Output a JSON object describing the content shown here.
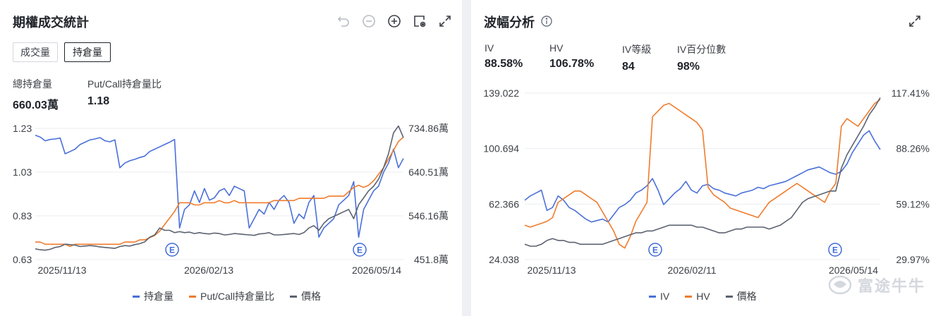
{
  "left": {
    "title": "期權成交統計",
    "tabs": [
      "成交量",
      "持倉量"
    ],
    "active_tab": 1,
    "stats": [
      {
        "label": "總持倉量",
        "value": "660.03萬"
      },
      {
        "label": "Put/Call持倉量比",
        "value": "1.18"
      }
    ],
    "legend": [
      "持倉量",
      "Put/Call持倉量比",
      "價格"
    ],
    "event_marker": "E"
  },
  "right": {
    "title": "波幅分析",
    "stats": [
      {
        "label": "IV",
        "value": "88.58%"
      },
      {
        "label": "HV",
        "value": "106.78%"
      },
      {
        "label": "IV等級",
        "value": "84"
      },
      {
        "label": "IV百分位數",
        "value": "98%"
      }
    ],
    "legend": [
      "IV",
      "HV",
      "價格"
    ],
    "event_marker": "E"
  },
  "watermark": "富途牛牛",
  "colors": {
    "blue": "#4a70d9",
    "orange": "#f07b2c",
    "gray": "#5b6270",
    "marker": "#3f6ad8"
  },
  "chart_data": [
    {
      "type": "line",
      "x_labels": [
        "2025/11/13",
        "2026/02/13",
        "2026/05/14"
      ],
      "left_axis_ticks": [
        "1.23",
        "1.03",
        "0.83",
        "0.63"
      ],
      "left_axis_range": [
        0.63,
        1.23
      ],
      "right_axis_ticks": [
        "734.86萬",
        "640.51萬",
        "546.16萬",
        "451.8萬"
      ],
      "right_axis_range": [
        451.8,
        734.86
      ],
      "series": [
        {
          "name": "持倉量",
          "axis": "right",
          "color": "#4a70d9",
          "values": [
            720,
            716,
            708,
            711,
            712,
            714,
            680,
            685,
            690,
            700,
            705,
            710,
            712,
            715,
            708,
            706,
            710,
            650,
            660,
            665,
            668,
            672,
            675,
            685,
            690,
            695,
            700,
            705,
            711,
            520,
            560,
            570,
            600,
            575,
            605,
            580,
            585,
            600,
            605,
            590,
            610,
            605,
            600,
            520,
            540,
            560,
            550,
            575,
            560,
            580,
            590,
            575,
            530,
            550,
            540,
            575,
            590,
            500,
            520,
            530,
            540,
            570,
            580,
            590,
            620,
            500,
            560,
            580,
            600,
            610,
            640,
            660,
            690,
            650,
            670
          ]
        },
        {
          "name": "Put/Call持倉量比",
          "axis": "left",
          "color": "#f07b2c",
          "values": [
            0.71,
            0.71,
            0.7,
            0.7,
            0.7,
            0.7,
            0.7,
            0.69,
            0.7,
            0.7,
            0.7,
            0.7,
            0.7,
            0.7,
            0.7,
            0.7,
            0.7,
            0.7,
            0.71,
            0.71,
            0.71,
            0.72,
            0.72,
            0.73,
            0.74,
            0.76,
            0.79,
            0.82,
            0.85,
            0.89,
            0.89,
            0.89,
            0.88,
            0.88,
            0.89,
            0.89,
            0.89,
            0.9,
            0.89,
            0.89,
            0.9,
            0.89,
            0.89,
            0.89,
            0.89,
            0.89,
            0.89,
            0.89,
            0.9,
            0.9,
            0.9,
            0.9,
            0.9,
            0.91,
            0.91,
            0.91,
            0.91,
            0.91,
            0.91,
            0.92,
            0.92,
            0.92,
            0.92,
            0.94,
            0.96,
            0.97,
            0.96,
            0.97,
            0.99,
            1.02,
            1.05,
            1.09,
            1.13,
            1.17,
            1.19
          ]
        },
        {
          "name": "價格",
          "axis": "right",
          "color": "#5b6270",
          "values": [
            475,
            473,
            472,
            474,
            478,
            480,
            485,
            484,
            483,
            480,
            481,
            482,
            481,
            479,
            478,
            477,
            476,
            480,
            482,
            481,
            484,
            486,
            490,
            500,
            505,
            520,
            515,
            515,
            510,
            512,
            510,
            511,
            508,
            510,
            508,
            507,
            509,
            508,
            505,
            506,
            508,
            507,
            506,
            505,
            504,
            507,
            508,
            510,
            505,
            505,
            506,
            507,
            508,
            506,
            510,
            520,
            525,
            515,
            530,
            540,
            545,
            550,
            555,
            560,
            540,
            570,
            585,
            600,
            610,
            625,
            650,
            680,
            725,
            740,
            715
          ]
        }
      ]
    },
    {
      "type": "line",
      "x_labels": [
        "2025/11/13",
        "2026/02/11",
        "2026/05/14"
      ],
      "left_axis_ticks": [
        "139.022",
        "100.694",
        "62.366",
        "24.038"
      ],
      "left_axis_range": [
        24.038,
        139.022
      ],
      "right_axis_ticks": [
        "117.41%",
        "88.26%",
        "59.12%",
        "29.97%"
      ],
      "right_axis_range": [
        29.97,
        117.41
      ],
      "series": [
        {
          "name": "IV",
          "axis": "left",
          "color": "#4a70d9",
          "values": [
            65,
            68,
            70,
            72,
            58,
            60,
            68,
            65,
            60,
            58,
            55,
            52,
            50,
            51,
            52,
            50,
            55,
            60,
            62,
            65,
            70,
            72,
            75,
            80,
            72,
            62,
            66,
            70,
            73,
            78,
            72,
            70,
            75,
            76,
            73,
            72,
            70,
            69,
            68,
            70,
            71,
            72,
            74,
            73,
            75,
            76,
            77,
            78,
            80,
            82,
            84,
            86,
            87,
            88,
            86,
            84,
            83,
            85,
            90,
            98,
            104,
            110,
            113,
            106,
            100
          ]
        },
        {
          "name": "HV",
          "axis": "right",
          "color": "#f07b2c",
          "values": [
            48,
            47,
            48,
            49,
            50,
            52,
            60,
            62,
            64,
            66,
            66,
            64,
            62,
            60,
            55,
            50,
            45,
            38,
            36,
            42,
            50,
            55,
            60,
            105,
            108,
            111,
            112,
            110,
            108,
            106,
            104,
            102,
            98,
            68,
            64,
            62,
            60,
            57,
            56,
            55,
            54,
            53,
            52,
            56,
            60,
            62,
            64,
            66,
            68,
            70,
            68,
            66,
            64,
            62,
            60,
            66,
            70,
            100,
            104,
            102,
            100,
            104,
            108,
            112,
            114
          ]
        },
        {
          "name": "價格",
          "axis": "right",
          "color": "#5b6270",
          "values": [
            38,
            37,
            37,
            38,
            40,
            41,
            40,
            40,
            39,
            39,
            38,
            38,
            38,
            38,
            38,
            39,
            40,
            41,
            42,
            43,
            44,
            44,
            45,
            45,
            46,
            47,
            48,
            48,
            48,
            48,
            48,
            47,
            47,
            46,
            45,
            44,
            44,
            45,
            46,
            46,
            47,
            47,
            47,
            47,
            46,
            47,
            48,
            50,
            52,
            56,
            60,
            62,
            63,
            64,
            65,
            66,
            66,
            78,
            85,
            90,
            95,
            100,
            106,
            110,
            115
          ]
        }
      ]
    }
  ]
}
